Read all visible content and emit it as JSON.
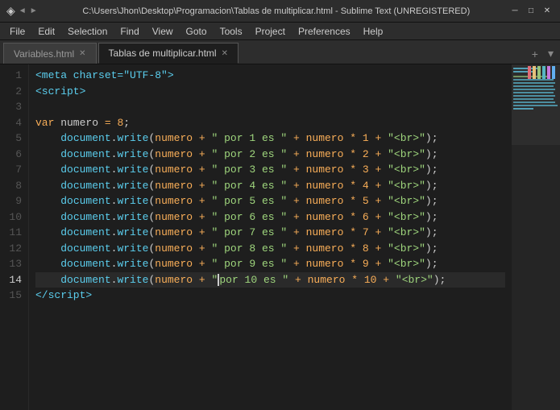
{
  "titlebar": {
    "icon": "●",
    "title": "C:\\Users\\Jhon\\Desktop\\Programacion\\Tablas de multiplicar.html - Sublime Text (UNREGISTERED)",
    "minimize": "─",
    "maximize": "□",
    "close": "✕"
  },
  "menubar": {
    "items": [
      "File",
      "Edit",
      "Selection",
      "Find",
      "View",
      "Goto",
      "Tools",
      "Project",
      "Preferences",
      "Help"
    ]
  },
  "tabs": [
    {
      "label": "Variables.html",
      "active": false
    },
    {
      "label": "Tablas de multiplicar.html",
      "active": true
    }
  ],
  "lines": [
    {
      "num": "1",
      "content": "meta_line"
    },
    {
      "num": "2",
      "content": "script_open"
    },
    {
      "num": "3",
      "content": "blank"
    },
    {
      "num": "4",
      "content": "var_line"
    },
    {
      "num": "5",
      "content": "dw_1"
    },
    {
      "num": "6",
      "content": "dw_2"
    },
    {
      "num": "7",
      "content": "dw_3"
    },
    {
      "num": "8",
      "content": "dw_4"
    },
    {
      "num": "9",
      "content": "dw_5"
    },
    {
      "num": "10",
      "content": "dw_6"
    },
    {
      "num": "11",
      "content": "dw_7"
    },
    {
      "num": "12",
      "content": "dw_8"
    },
    {
      "num": "13",
      "content": "dw_9"
    },
    {
      "num": "14",
      "content": "dw_10",
      "active": true
    },
    {
      "num": "15",
      "content": "script_close"
    }
  ]
}
